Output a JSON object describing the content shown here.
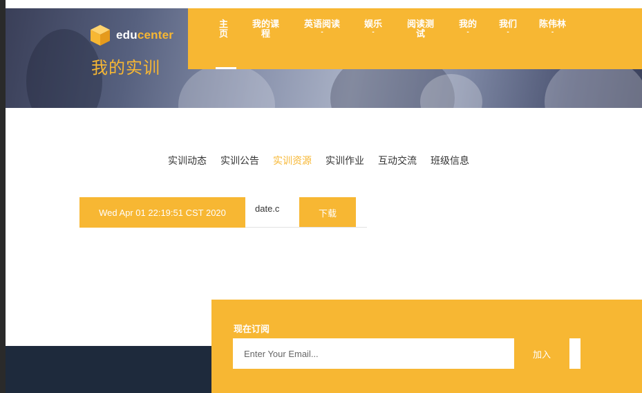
{
  "colors": {
    "accent": "#f7b733",
    "footer_dark": "#1e2a3c",
    "text": "#333333"
  },
  "brand": {
    "edu": "edu",
    "center": "center",
    "icon": "cube-logo-icon"
  },
  "header": {
    "page_title": "我的实训"
  },
  "nav": {
    "items": [
      {
        "line1": "主",
        "line2": "页",
        "dot": ""
      },
      {
        "line1": "我的课",
        "line2": "程",
        "dot": ""
      },
      {
        "line1": "英语阅读",
        "line2": "",
        "dot": "-"
      },
      {
        "line1": "娱乐",
        "line2": "",
        "dot": "-"
      },
      {
        "line1": "阅读测",
        "line2": "试",
        "dot": ""
      },
      {
        "line1": "我的",
        "line2": "",
        "dot": "-"
      },
      {
        "line1": "我们",
        "line2": "",
        "dot": "-"
      },
      {
        "line1": "陈伟林",
        "line2": "",
        "dot": "-"
      }
    ]
  },
  "tabs": [
    {
      "label": "实训动态",
      "active": false
    },
    {
      "label": "实训公告",
      "active": false
    },
    {
      "label": "实训资源",
      "active": true
    },
    {
      "label": "实训作业",
      "active": false
    },
    {
      "label": "互动交流",
      "active": false
    },
    {
      "label": "班级信息",
      "active": false
    }
  ],
  "resource": {
    "date": "Wed Apr 01 22:19:51 CST 2020",
    "filename": "date.c",
    "download_label": "下载"
  },
  "subscribe": {
    "title": "现在订阅",
    "email_placeholder": "Enter Your Email...",
    "button_label": "加入"
  }
}
